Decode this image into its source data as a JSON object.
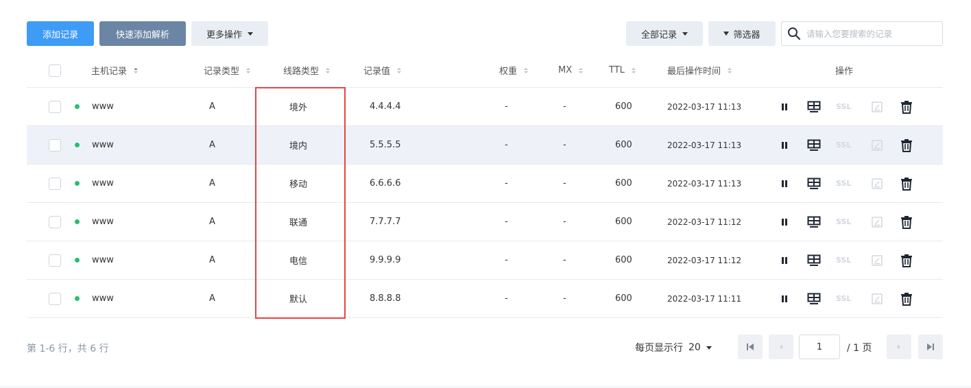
{
  "toolbar": {
    "add_record": "添加记录",
    "quick_add": "快速添加解析",
    "more_actions": "更多操作",
    "all_records": "全部记录",
    "filter": "筛选器",
    "search_placeholder": "请输入您要搜索的记录"
  },
  "table": {
    "headers": {
      "host": "主机记录",
      "type": "记录类型",
      "line": "线路类型",
      "value": "记录值",
      "weight": "权重",
      "mx": "MX",
      "ttl": "TTL",
      "last_modified": "最后操作时间",
      "actions": "操作"
    },
    "rows": [
      {
        "host": "www",
        "type": "A",
        "line": "境外",
        "value": "4.4.4.4",
        "weight": "-",
        "mx": "-",
        "ttl": "600",
        "time": "2022-03-17 11:13",
        "ssl": "SSL",
        "status": "enabled"
      },
      {
        "host": "www",
        "type": "A",
        "line": "境内",
        "value": "5.5.5.5",
        "weight": "-",
        "mx": "-",
        "ttl": "600",
        "time": "2022-03-17 11:13",
        "ssl": "SSL",
        "status": "enabled"
      },
      {
        "host": "www",
        "type": "A",
        "line": "移动",
        "value": "6.6.6.6",
        "weight": "-",
        "mx": "-",
        "ttl": "600",
        "time": "2022-03-17 11:13",
        "ssl": "SSL",
        "status": "enabled"
      },
      {
        "host": "www",
        "type": "A",
        "line": "联通",
        "value": "7.7.7.7",
        "weight": "-",
        "mx": "-",
        "ttl": "600",
        "time": "2022-03-17 11:12",
        "ssl": "SSL",
        "status": "enabled"
      },
      {
        "host": "www",
        "type": "A",
        "line": "电信",
        "value": "9.9.9.9",
        "weight": "-",
        "mx": "-",
        "ttl": "600",
        "time": "2022-03-17 11:12",
        "ssl": "SSL",
        "status": "enabled"
      },
      {
        "host": "www",
        "type": "A",
        "line": "默认",
        "value": "8.8.8.8",
        "weight": "-",
        "mx": "-",
        "ttl": "600",
        "time": "2022-03-17 11:11",
        "ssl": "SSL",
        "status": "enabled"
      }
    ]
  },
  "pagination": {
    "summary": "第 1-6 行，共 6 行",
    "page_size_label": "每页显示行",
    "page_size": "20",
    "current_page": "1",
    "total_pages": "/ 1 页"
  },
  "colors": {
    "primary": "#3e9bf6",
    "secondary": "#6b85a5",
    "status_dot": "#24c06e",
    "highlight_border": "#e84343",
    "row_highlight": "#eef2f8"
  },
  "icons": {
    "pause": "pause-icon",
    "resolve": "resolve-icon",
    "edit": "edit-icon",
    "delete": "trash-icon",
    "search": "search-icon",
    "filter": "filter-icon"
  }
}
